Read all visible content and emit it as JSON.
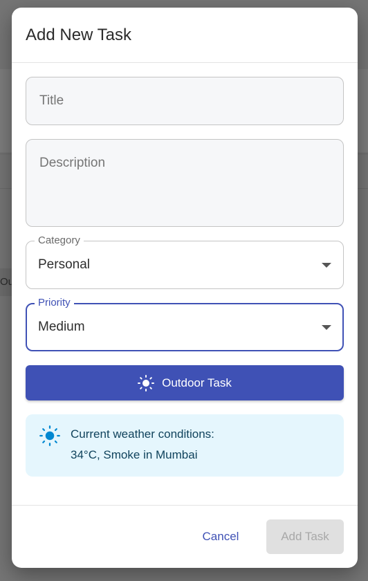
{
  "background": {
    "partial_text": "Ou"
  },
  "dialog": {
    "title": "Add New Task",
    "title_field": {
      "placeholder": "Title",
      "value": ""
    },
    "description_field": {
      "placeholder": "Description",
      "value": ""
    },
    "category": {
      "label": "Category",
      "value": "Personal"
    },
    "priority": {
      "label": "Priority",
      "value": "Medium"
    },
    "outdoor_button": {
      "label": "Outdoor Task",
      "icon": "sun-icon"
    },
    "weather": {
      "icon": "sun-icon",
      "line1": "Current weather conditions:",
      "line2": "34°C, Smoke in Mumbai"
    },
    "footer": {
      "cancel_label": "Cancel",
      "add_label": "Add Task"
    }
  },
  "colors": {
    "primary": "#3f51b5",
    "weather_bg": "#e5f6fd",
    "weather_text": "#10435c",
    "weather_icon": "#0288d1",
    "disabled_bg": "#e0e0e0",
    "disabled_text": "#a8a8a8"
  }
}
